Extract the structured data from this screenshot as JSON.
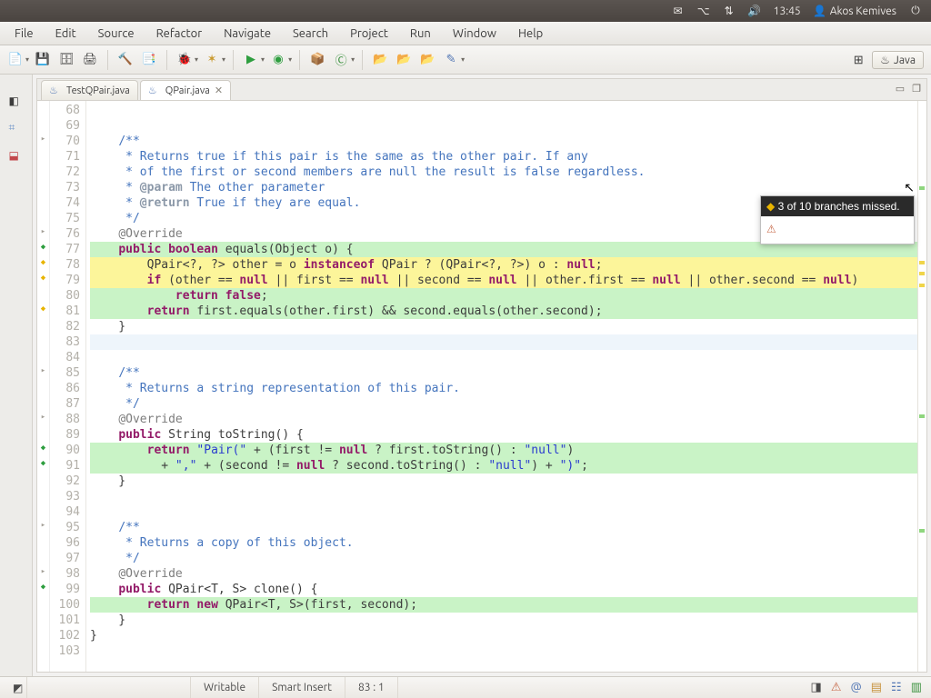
{
  "os": {
    "time": "13:45",
    "user": "Akos Kemives"
  },
  "menu": [
    "File",
    "Edit",
    "Source",
    "Refactor",
    "Navigate",
    "Search",
    "Project",
    "Run",
    "Window",
    "Help"
  ],
  "perspective": {
    "label": "Java"
  },
  "tabs": [
    {
      "icon": "java-file-icon",
      "label": "TestQPair.java",
      "active": false
    },
    {
      "icon": "java-file-icon",
      "label": "QPair.java",
      "active": true
    }
  ],
  "status": {
    "writable": "Writable",
    "mode": "Smart Insert",
    "pos": "83 : 1"
  },
  "hover": {
    "title": "3 of 10 branches missed."
  },
  "code": {
    "start": 68,
    "lines": [
      {
        "n": 68,
        "m": "",
        "h": "",
        "html": ""
      },
      {
        "n": 69,
        "m": "",
        "h": "",
        "html": ""
      },
      {
        "n": 70,
        "m": "t",
        "h": "",
        "html": "    <span class='cmt'>/**</span>"
      },
      {
        "n": 71,
        "m": "",
        "h": "",
        "html": "    <span class='cmt'> * Returns true if this pair is the same as the other pair. If any</span>"
      },
      {
        "n": 72,
        "m": "",
        "h": "",
        "html": "    <span class='cmt'> * of the first or second members are null the result is false regardless.</span>"
      },
      {
        "n": 73,
        "m": "",
        "h": "",
        "html": "    <span class='cmt'> * <span class='tag'>@param</span> The other parameter</span>"
      },
      {
        "n": 74,
        "m": "",
        "h": "",
        "html": "    <span class='cmt'> * <span class='tag'>@return</span> True if they are equal.</span>"
      },
      {
        "n": 75,
        "m": "",
        "h": "",
        "html": "    <span class='cmt'> */</span>"
      },
      {
        "n": 76,
        "m": "t",
        "h": "",
        "html": "    <span class='ann'>@Override</span>"
      },
      {
        "n": 77,
        "m": "g",
        "h": "g",
        "html": "    <span class='kw'>public</span> <span class='kw'>boolean</span> equals(Object o) {"
      },
      {
        "n": 78,
        "m": "y",
        "h": "y",
        "html": "        QPair&lt;?, ?&gt; other = o <span class='kw'>instanceof</span> QPair ? (QPair&lt;?, ?&gt;) o : <span class='lit'>null</span>;"
      },
      {
        "n": 79,
        "m": "y",
        "h": "y",
        "html": "        <span class='kw'>if</span> (other == <span class='lit'>null</span> || first == <span class='lit'>null</span> || second == <span class='lit'>null</span> || other.first == <span class='lit'>null</span> || other.second == <span class='lit'>null</span>)"
      },
      {
        "n": 80,
        "m": "",
        "h": "g",
        "html": "            <span class='kw'>return</span> <span class='lit'>false</span>;"
      },
      {
        "n": 81,
        "m": "y",
        "h": "g",
        "html": "        <span class='kw'>return</span> first.equals(other.first) &amp;&amp; second.equals(other.second);"
      },
      {
        "n": 82,
        "m": "",
        "h": "",
        "html": "    }"
      },
      {
        "n": 83,
        "m": "",
        "h": "cur",
        "html": ""
      },
      {
        "n": 84,
        "m": "",
        "h": "",
        "html": ""
      },
      {
        "n": 85,
        "m": "t",
        "h": "",
        "html": "    <span class='cmt'>/**</span>"
      },
      {
        "n": 86,
        "m": "",
        "h": "",
        "html": "    <span class='cmt'> * Returns a string representation of this pair.</span>"
      },
      {
        "n": 87,
        "m": "",
        "h": "",
        "html": "    <span class='cmt'> */</span>"
      },
      {
        "n": 88,
        "m": "t",
        "h": "",
        "html": "    <span class='ann'>@Override</span>"
      },
      {
        "n": 89,
        "m": "",
        "h": "",
        "html": "    <span class='kw'>public</span> String toString() {"
      },
      {
        "n": 90,
        "m": "g",
        "h": "g",
        "html": "        <span class='kw'>return</span> <span class='str'>\"Pair(\"</span> + (first != <span class='lit'>null</span> ? first.toString() : <span class='str'>\"null\"</span>)"
      },
      {
        "n": 91,
        "m": "g",
        "h": "g",
        "html": "          + <span class='str'>\",\"</span> + (second != <span class='lit'>null</span> ? second.toString() : <span class='str'>\"null\"</span>) + <span class='str'>\")\"</span>;"
      },
      {
        "n": 92,
        "m": "",
        "h": "",
        "html": "    }"
      },
      {
        "n": 93,
        "m": "",
        "h": "",
        "html": ""
      },
      {
        "n": 94,
        "m": "",
        "h": "",
        "html": ""
      },
      {
        "n": 95,
        "m": "t",
        "h": "",
        "html": "    <span class='cmt'>/**</span>"
      },
      {
        "n": 96,
        "m": "",
        "h": "",
        "html": "    <span class='cmt'> * Returns a copy of this object.</span>"
      },
      {
        "n": 97,
        "m": "",
        "h": "",
        "html": "    <span class='cmt'> */</span>"
      },
      {
        "n": 98,
        "m": "t",
        "h": "",
        "html": "    <span class='ann'>@Override</span>"
      },
      {
        "n": 99,
        "m": "g",
        "h": "",
        "html": "    <span class='kw'>public</span> QPair&lt;T, S&gt; clone() {"
      },
      {
        "n": 100,
        "m": "",
        "h": "g",
        "html": "        <span class='kw'>return</span> <span class='kw'>new</span> QPair&lt;T, S&gt;(first, second);"
      },
      {
        "n": 101,
        "m": "",
        "h": "",
        "html": "    }"
      },
      {
        "n": 102,
        "m": "",
        "h": "",
        "html": "}"
      },
      {
        "n": 103,
        "m": "",
        "h": "",
        "html": ""
      }
    ]
  }
}
